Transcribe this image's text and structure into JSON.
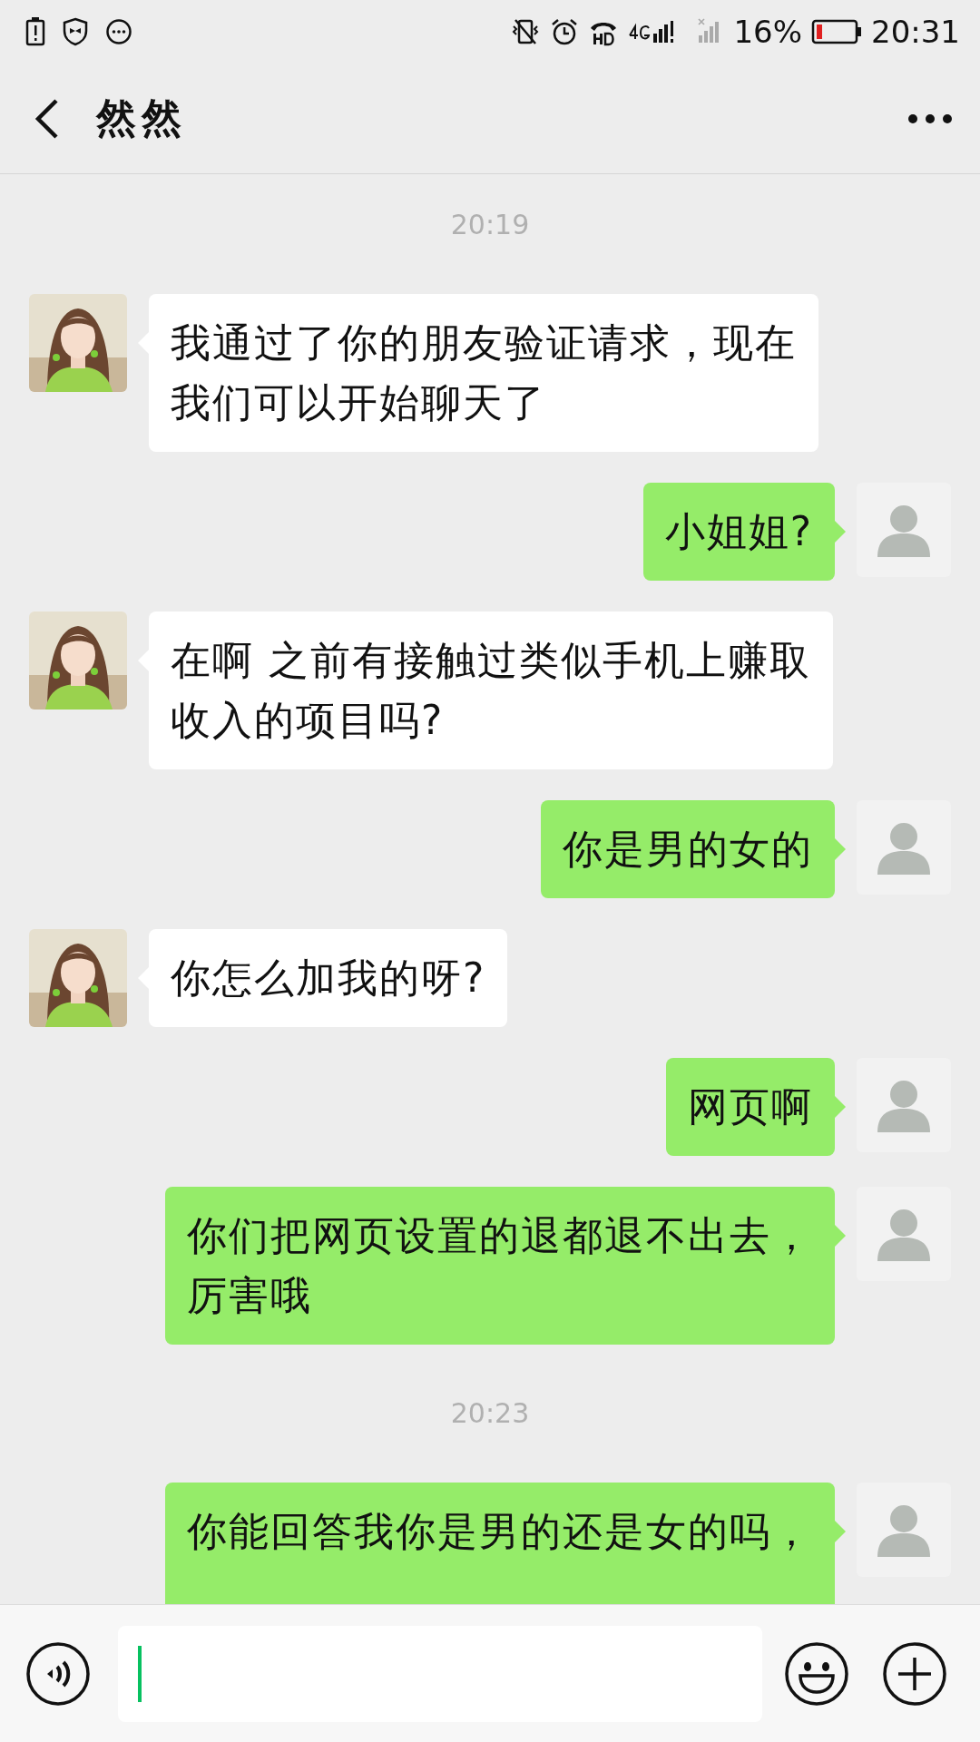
{
  "status_bar": {
    "battery": "16%",
    "time": "20:31"
  },
  "header": {
    "title": "然然"
  },
  "messages": [
    {
      "kind": "time",
      "text": "20:19"
    },
    {
      "kind": "incoming",
      "lines": [
        "我通过了你的朋友验证请求，现在",
        "我们可以开始聊天了"
      ]
    },
    {
      "kind": "outgoing",
      "lines": [
        "小姐姐?"
      ]
    },
    {
      "kind": "incoming",
      "lines": [
        "在啊 之前有接触过类似手机上赚取",
        "收入的项目吗?"
      ]
    },
    {
      "kind": "outgoing",
      "lines": [
        "你是男的女的"
      ]
    },
    {
      "kind": "incoming",
      "lines": [
        "你怎么加我的呀?"
      ]
    },
    {
      "kind": "outgoing",
      "lines": [
        "网页啊"
      ]
    },
    {
      "kind": "outgoing",
      "lines": [
        "你们把网页设置的退都退不出去，",
        "厉害哦"
      ]
    },
    {
      "kind": "time",
      "text": "20:23"
    },
    {
      "kind": "outgoing",
      "lines": [
        "你能回答我你是男的还是女的吗，"
      ],
      "cut": true
    }
  ]
}
